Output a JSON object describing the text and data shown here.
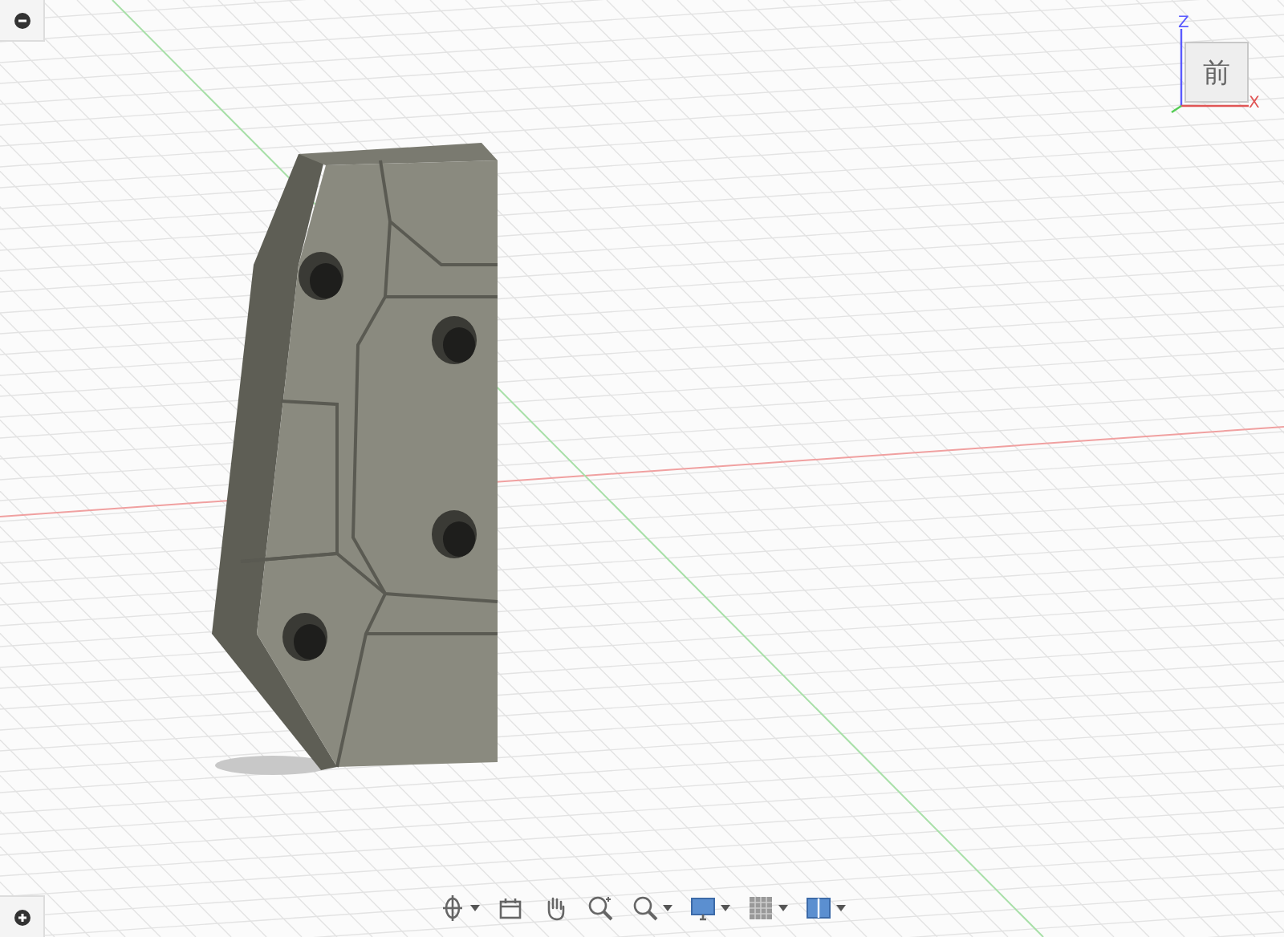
{
  "viewcube": {
    "face": "前",
    "axes": [
      {
        "label": "Z",
        "kind": "z"
      },
      {
        "label": "X",
        "kind": "x"
      }
    ]
  },
  "corner_buttons": [
    {
      "kind": "collapse"
    },
    {
      "kind": "expand"
    }
  ],
  "toolbar": {
    "tools": [
      {
        "kind": "orbit",
        "dropdown": true
      },
      {
        "kind": "look",
        "dropdown": false
      },
      {
        "kind": "pan",
        "dropdown": false
      },
      {
        "kind": "zoom-window",
        "dropdown": false
      },
      {
        "kind": "zoom",
        "dropdown": true
      },
      {
        "kind": "display",
        "dropdown": true
      },
      {
        "kind": "grid",
        "dropdown": true
      },
      {
        "kind": "viewports",
        "dropdown": true
      }
    ]
  }
}
